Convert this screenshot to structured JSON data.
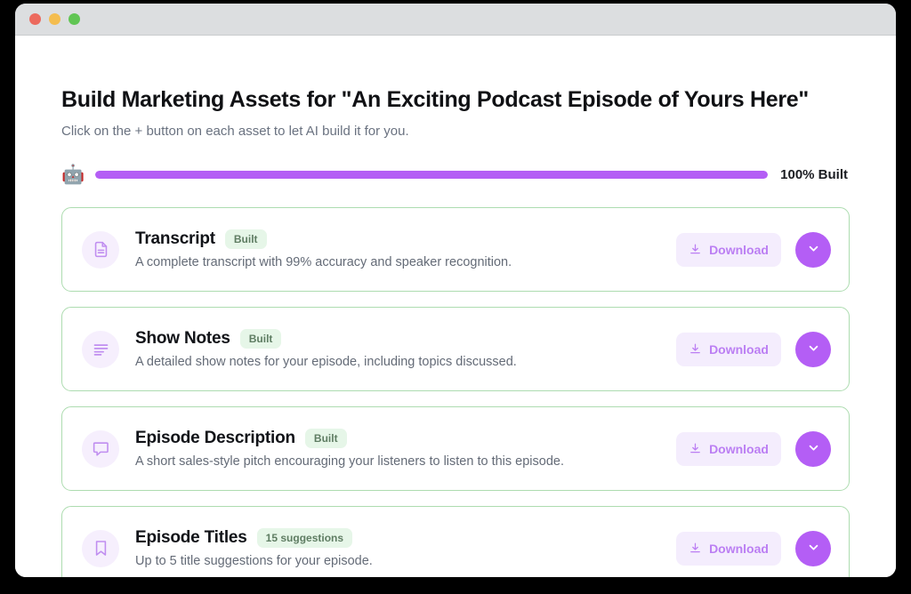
{
  "window": {
    "traffic_lights": [
      "close",
      "minimize",
      "maximize"
    ]
  },
  "header": {
    "title": "Build Marketing Assets for \"An Exciting Podcast Episode of Yours Here\"",
    "subtitle": "Click on the + button on each asset to let AI build it for you."
  },
  "progress": {
    "icon": "robot-icon",
    "emoji": "🤖",
    "percent": 100,
    "label": "100% Built",
    "fill_color": "#b45ef5",
    "track_color": "#ede9fb"
  },
  "colors": {
    "accent_purple": "#b45ef5",
    "icon_bg": "#f6effd",
    "badge_bg": "#e6f6e8",
    "badge_text": "#5f7d63",
    "card_border": "#addcb0",
    "download_bg": "#f4edfd",
    "download_text": "#bb7ef3"
  },
  "assets": [
    {
      "icon": "document-icon",
      "title": "Transcript",
      "badge": "Built",
      "description": "A complete transcript with 99% accuracy and speaker recognition.",
      "download_label": "Download",
      "expand_icon": "chevron-down-icon"
    },
    {
      "icon": "list-lines-icon",
      "title": "Show Notes",
      "badge": "Built",
      "description": "A detailed show notes for your episode, including topics discussed.",
      "download_label": "Download",
      "expand_icon": "chevron-down-icon"
    },
    {
      "icon": "chat-bubble-icon",
      "title": "Episode Description",
      "badge": "Built",
      "description": "A short sales-style pitch encouraging your listeners to listen to this episode.",
      "download_label": "Download",
      "expand_icon": "chevron-down-icon"
    },
    {
      "icon": "bookmark-icon",
      "title": "Episode Titles",
      "badge": "15 suggestions",
      "description": "Up to 5 title suggestions for your episode.",
      "download_label": "Download",
      "expand_icon": "chevron-down-icon"
    }
  ]
}
